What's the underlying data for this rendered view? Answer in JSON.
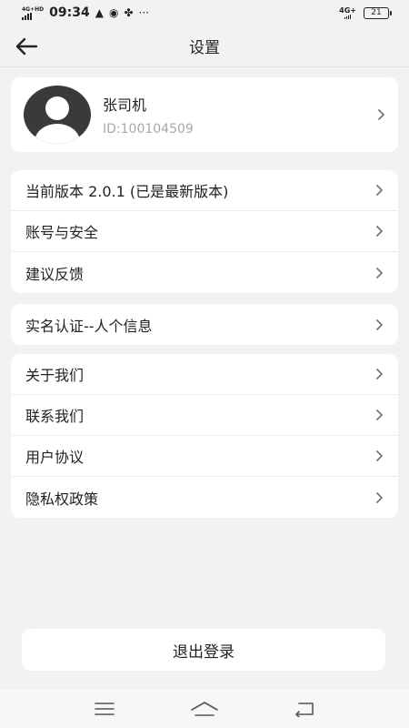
{
  "status_bar": {
    "network": "4G+HD",
    "time": "09:34",
    "more": "···",
    "right_network": "4G+",
    "battery": "21"
  },
  "header": {
    "title": "设置"
  },
  "profile": {
    "name": "张司机",
    "id": "ID:100104509"
  },
  "groups": [
    {
      "items": [
        {
          "label": "当前版本 2.0.1 (已是最新版本)"
        },
        {
          "label": "账号与安全"
        },
        {
          "label": "建议反馈"
        }
      ]
    },
    {
      "items": [
        {
          "label": "实名认证--人个信息"
        }
      ]
    },
    {
      "items": [
        {
          "label": "关于我们"
        },
        {
          "label": "联系我们"
        },
        {
          "label": "用户协议"
        },
        {
          "label": "隐私权政策"
        }
      ]
    }
  ],
  "logout": {
    "label": "退出登录"
  },
  "icons": {
    "back": "arrow-left-icon",
    "chevron": "chevron-right-icon",
    "avatar": "person-silhouette-icon",
    "menu": "menu-icon",
    "home": "home-icon",
    "return": "return-icon"
  },
  "colors": {
    "background": "#f2f2f2",
    "card": "#ffffff",
    "avatar": "#3a3a3a",
    "muted_text": "#a8a8a8"
  }
}
